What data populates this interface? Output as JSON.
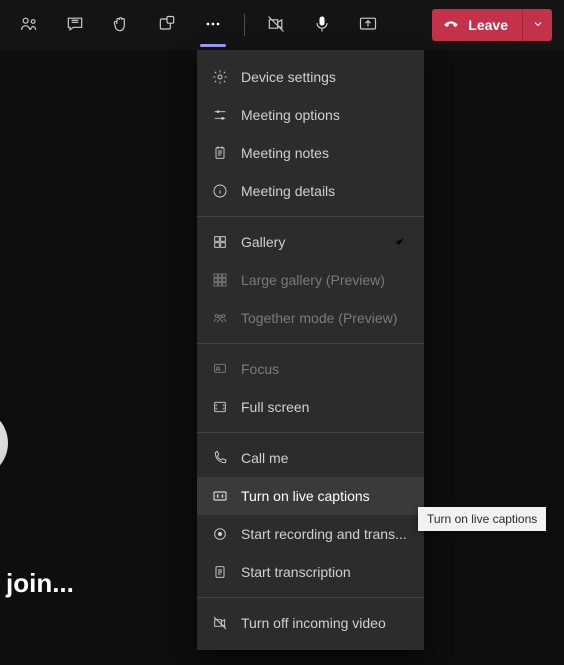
{
  "toolbar": {
    "leave_label": "Leave"
  },
  "menu": {
    "device_settings": "Device settings",
    "meeting_options": "Meeting options",
    "meeting_notes": "Meeting notes",
    "meeting_details": "Meeting details",
    "gallery": "Gallery",
    "large_gallery": "Large gallery (Preview)",
    "together_mode": "Together mode (Preview)",
    "focus": "Focus",
    "full_screen": "Full screen",
    "call_me": "Call me",
    "live_captions": "Turn on live captions",
    "recording": "Start recording and trans...",
    "transcription": "Start transcription",
    "incoming_video": "Turn off incoming video"
  },
  "tooltip": {
    "live_captions": "Turn on live captions"
  },
  "status": {
    "waiting": "join..."
  }
}
